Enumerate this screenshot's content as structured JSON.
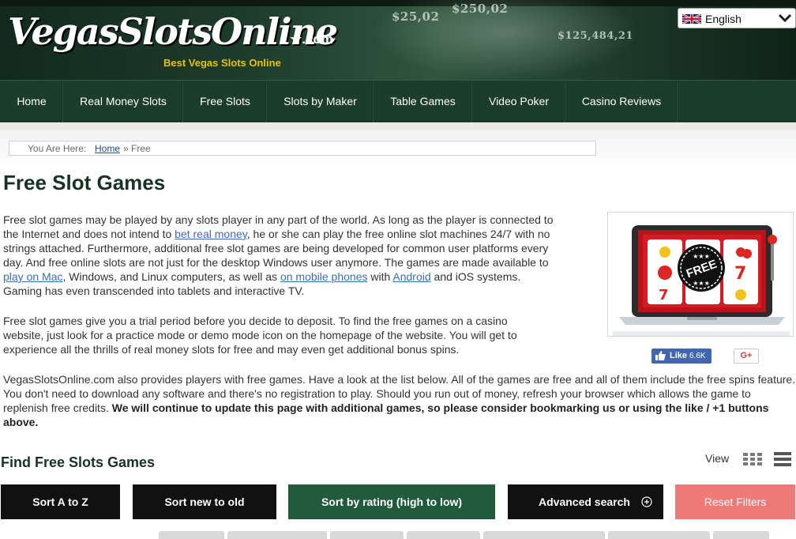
{
  "header": {
    "logo_text": "VegasSlotsOnline",
    "logo_suffix": "★.com",
    "tagline": "Best Vegas Slots Online",
    "banner_decor": [
      "$25,02",
      "$250,02",
      "$125,484,21"
    ],
    "language": {
      "label": "English",
      "flag_icon": "uk-flag-icon",
      "chevron_icon": "chevron-down-icon"
    }
  },
  "nav": {
    "items": [
      {
        "label": "Home"
      },
      {
        "label": "Real Money Slots"
      },
      {
        "label": "Free Slots"
      },
      {
        "label": "Slots by Maker"
      },
      {
        "label": "Table Games"
      },
      {
        "label": "Video Poker"
      },
      {
        "label": "Casino Reviews"
      }
    ]
  },
  "breadcrumb": {
    "prefix": "You Are Here:",
    "home": "Home",
    "current": "» Free"
  },
  "main": {
    "title": "Free Slot Games",
    "p1": {
      "t1": "Free slot games may be played by any slots player in any part of the world. As long as the player is connected to the Internet and does not intend to ",
      "link1": "bet real money",
      "t2": ", he or she can play the free online slot machines 24/7 with no strings attached. Furthermore, additional free slot games are being developed for common user platforms every day. And free online slots are not just for the desktop Windows user anymore. The games are made available to ",
      "link2": "play on Mac",
      "t3": ", Windows, and Linux computers, as well as ",
      "link3": "on mobile phones",
      "t4": " with ",
      "link4": "Android",
      "t5": " and iOS systems. Gaming has even transcended into tablets and interactive TV."
    },
    "p2": "Free slot games give you a trial period before you decide to deposit. To find the free games on a casino website, just look for a practice mode or demo mode icon on the homepage of the website. You will get to experience all the thrills of real money slots for free and may even get additional bonus spins.",
    "p3": {
      "text": "VegasSlotsOnline.com also provides players with free games. Have a look at the list below. All of the games are free and all of them include the free spins feature. You don't need to download any software and there's no registration to play. Should you run out of money, refresh your browser which allows the game to replenish free credits. ",
      "bold": "We will continue to update this page with additional games, so please consider bookmarking us or using the like / +1 buttons above."
    },
    "image_badge": "FREE"
  },
  "social": {
    "fb_like": "Like",
    "fb_count": "6.6K",
    "gplus": "G+"
  },
  "games": {
    "title": "Find Free Slots Games",
    "view_label": "View",
    "buttons": {
      "az": "Sort A to Z",
      "new": "Sort new to old",
      "rating": "Sort by rating (high to low)",
      "advanced": "Advanced search",
      "reset": "Reset Filters"
    }
  },
  "colors": {
    "nav_bg": "#1b3d2a",
    "active_button": "#1f5b3c",
    "reset_button": "#ee7a77",
    "link": "#3a6fb4",
    "heading": "#163325"
  }
}
